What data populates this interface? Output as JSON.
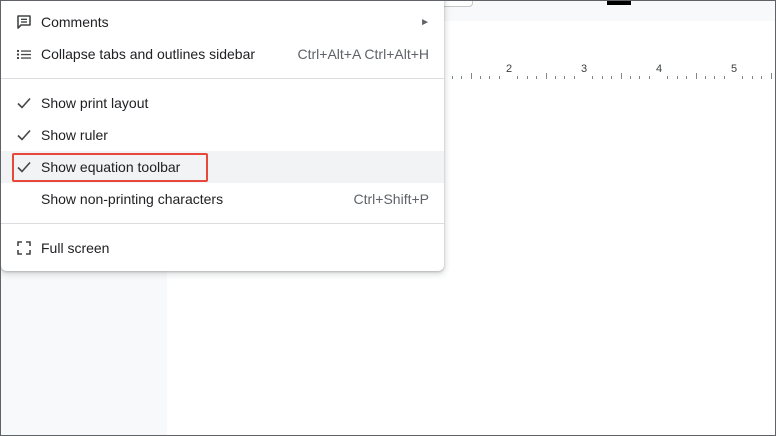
{
  "menu": {
    "items": [
      {
        "label": "Comments",
        "icon": "comment-icon",
        "has_submenu": true
      },
      {
        "label": "Collapse tabs and outlines sidebar",
        "icon": "list-icon",
        "shortcut": "Ctrl+Alt+A Ctrl+Alt+H"
      },
      {
        "label": "Show print layout",
        "icon": "check-icon",
        "checked": true
      },
      {
        "label": "Show ruler",
        "icon": "check-icon",
        "checked": true
      },
      {
        "label": "Show equation toolbar",
        "icon": "check-icon",
        "checked": true,
        "highlighted": true
      },
      {
        "label": "Show non-printing characters",
        "shortcut": "Ctrl+Shift+P"
      },
      {
        "label": "Full screen",
        "icon": "fullscreen-icon"
      }
    ]
  },
  "ruler": {
    "numbers": [
      "2",
      "3",
      "4",
      "5"
    ]
  },
  "colors": {
    "highlight_border": "#e8473b",
    "menu_text": "#202124",
    "shortcut_text": "#5f6368"
  }
}
